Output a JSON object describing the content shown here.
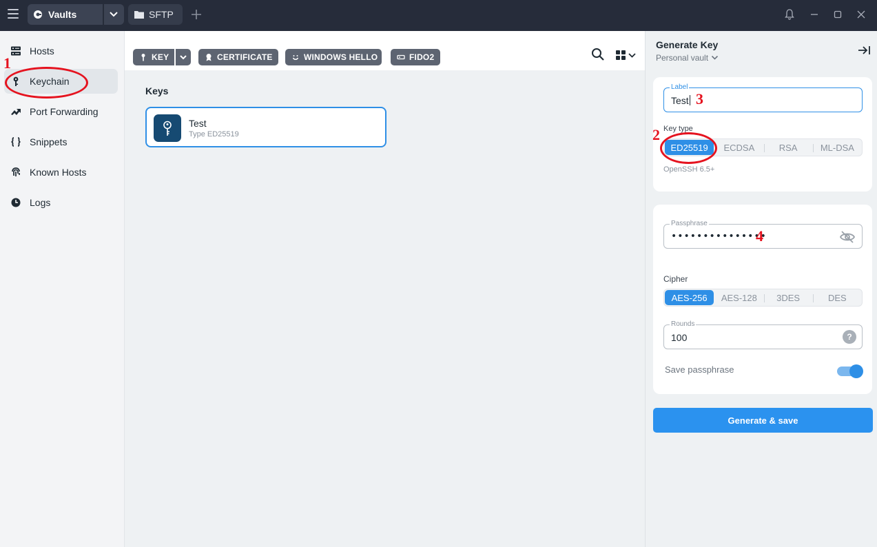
{
  "titlebar": {
    "vault_tab": "Vaults",
    "sftp_tab": "SFTP"
  },
  "sidebar": {
    "items": [
      {
        "label": "Hosts",
        "icon": "hosts-icon"
      },
      {
        "label": "Keychain",
        "icon": "key-icon"
      },
      {
        "label": "Port Forwarding",
        "icon": "port-forwarding-icon"
      },
      {
        "label": "Snippets",
        "icon": "braces-icon"
      },
      {
        "label": "Known Hosts",
        "icon": "fingerprint-icon"
      },
      {
        "label": "Logs",
        "icon": "clock-icon"
      }
    ]
  },
  "toolbar": {
    "key_label": "KEY",
    "certificate_label": "CERTIFICATE",
    "windows_hello_label": "WINDOWS HELLO",
    "fido2_label": "FIDO2"
  },
  "main": {
    "section_title": "Keys",
    "keys": [
      {
        "name": "Test",
        "type": "Type ED25519"
      }
    ]
  },
  "panel": {
    "title": "Generate Key",
    "vault": "Personal vault",
    "label_field": {
      "label": "Label",
      "value": "Test"
    },
    "key_type": {
      "label": "Key type",
      "options": [
        "ED25519",
        "ECDSA",
        "RSA",
        "ML-DSA"
      ],
      "selected": "ED25519",
      "hint": "OpenSSH 6.5+"
    },
    "passphrase_field": {
      "label": "Passphrase",
      "value": "•••••••••••••••"
    },
    "cipher": {
      "label": "Cipher",
      "options": [
        "AES-256",
        "AES-128",
        "3DES",
        "DES"
      ],
      "selected": "AES-256"
    },
    "rounds_field": {
      "label": "Rounds",
      "value": "100",
      "help": "?"
    },
    "save_passphrase": {
      "label": "Save passphrase",
      "enabled": true
    },
    "generate_button": "Generate & save"
  },
  "annotations": [
    "1",
    "2",
    "3",
    "4"
  ],
  "colors": {
    "titlebar": "#262c3a",
    "accent": "#2e8fe6",
    "annotation": "#e5131f",
    "toolbar_button": "#5d6471"
  }
}
